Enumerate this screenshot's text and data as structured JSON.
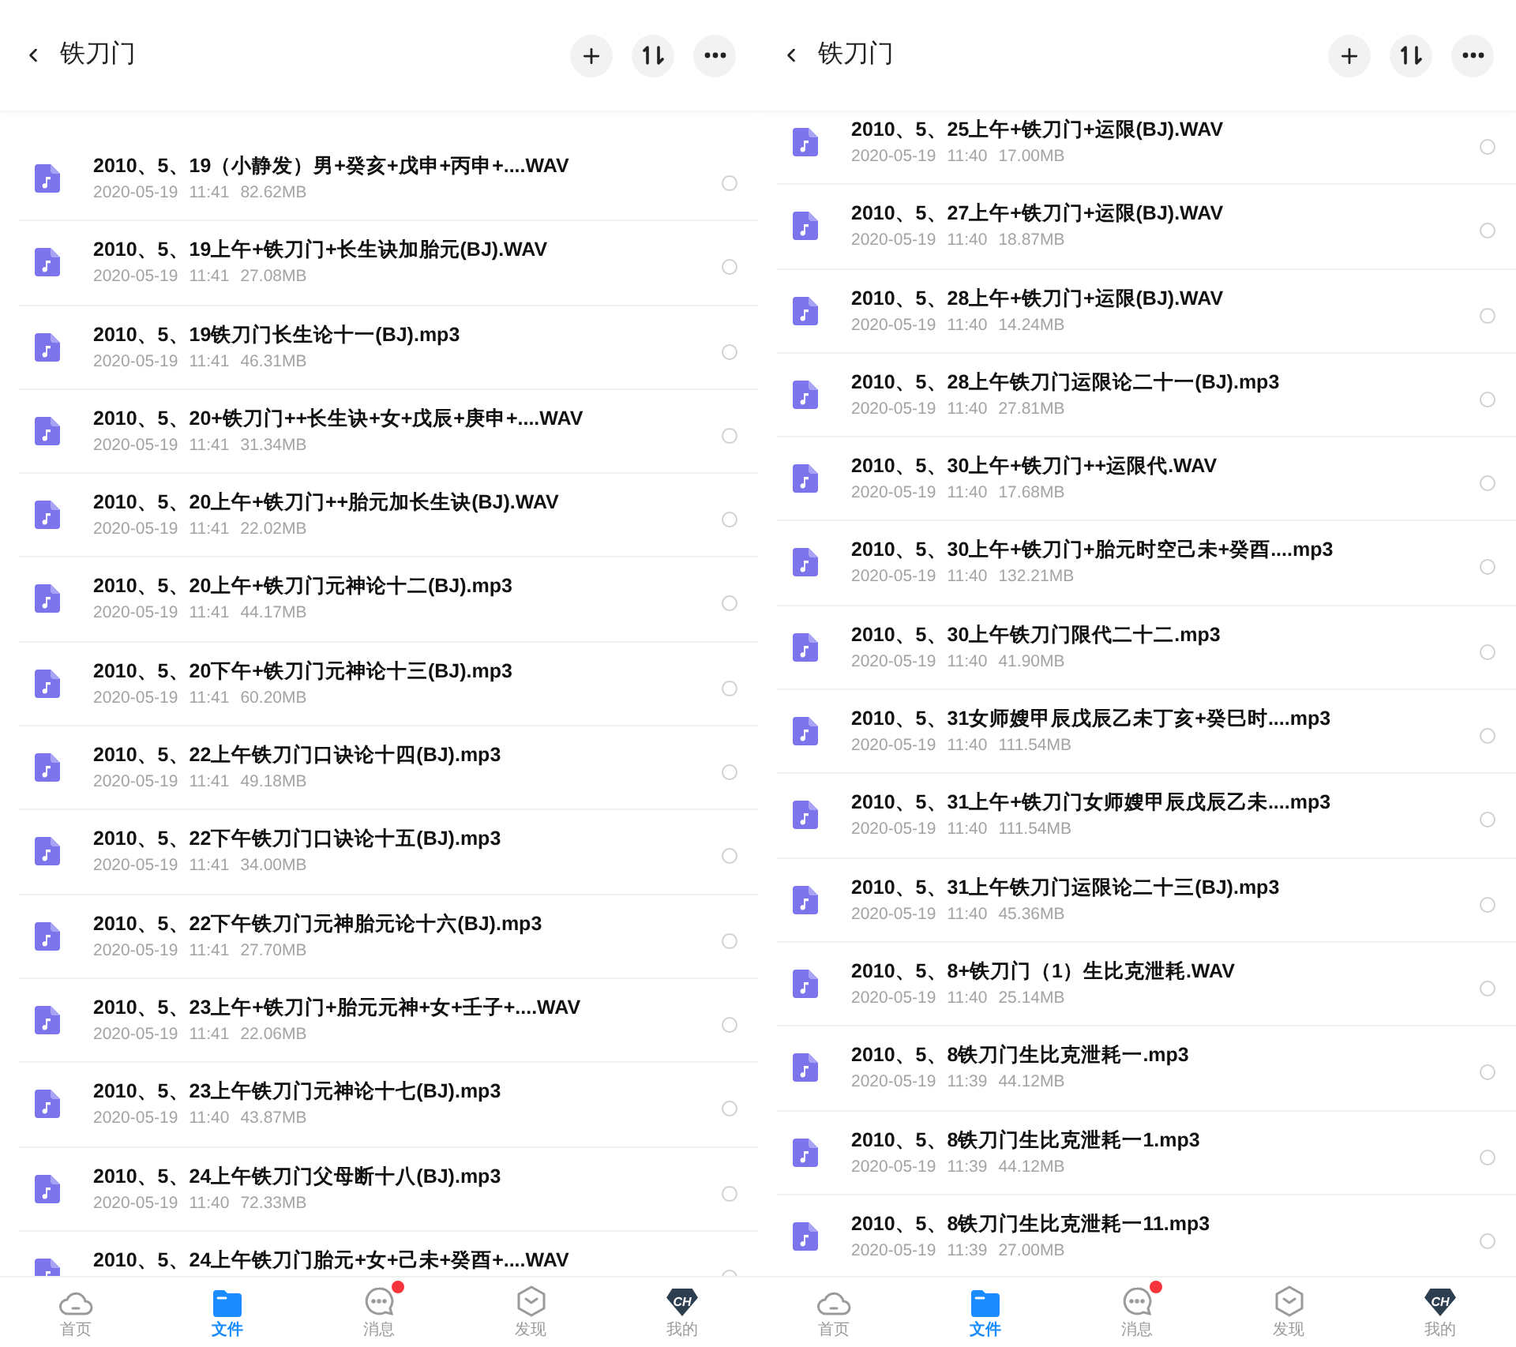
{
  "screens": [
    {
      "header": {
        "title": "铁刀门"
      },
      "files": [
        {
          "name": "2010、5、19（小静发）男+癸亥+戊申+丙申+....WAV",
          "date": "2020-05-19",
          "time": "11:41",
          "size": "82.62MB",
          "selected": false
        },
        {
          "name": "2010、5、19上午+铁刀门+长生诀加胎元(BJ).WAV",
          "date": "2020-05-19",
          "time": "11:41",
          "size": "27.08MB",
          "selected": false
        },
        {
          "name": "2010、5、19铁刀门长生论十一(BJ).mp3",
          "date": "2020-05-19",
          "time": "11:41",
          "size": "46.31MB",
          "selected": false
        },
        {
          "name": "2010、5、20+铁刀门++长生诀+女+戊辰+庚申+....WAV",
          "date": "2020-05-19",
          "time": "11:41",
          "size": "31.34MB",
          "selected": false
        },
        {
          "name": "2010、5、20上午+铁刀门++胎元加长生诀(BJ).WAV",
          "date": "2020-05-19",
          "time": "11:41",
          "size": "22.02MB",
          "selected": false
        },
        {
          "name": "2010、5、20上午+铁刀门元神论十二(BJ).mp3",
          "date": "2020-05-19",
          "time": "11:41",
          "size": "44.17MB",
          "selected": false
        },
        {
          "name": "2010、5、20下午+铁刀门元神论十三(BJ).mp3",
          "date": "2020-05-19",
          "time": "11:41",
          "size": "60.20MB",
          "selected": false
        },
        {
          "name": "2010、5、22上午铁刀门口诀论十四(BJ).mp3",
          "date": "2020-05-19",
          "time": "11:41",
          "size": "49.18MB",
          "selected": false
        },
        {
          "name": "2010、5、22下午铁刀门口诀论十五(BJ).mp3",
          "date": "2020-05-19",
          "time": "11:41",
          "size": "34.00MB",
          "selected": false
        },
        {
          "name": "2010、5、22下午铁刀门元神胎元论十六(BJ).mp3",
          "date": "2020-05-19",
          "time": "11:41",
          "size": "27.70MB",
          "selected": false
        },
        {
          "name": "2010、5、23上午+铁刀门+胎元元神+女+壬子+....WAV",
          "date": "2020-05-19",
          "time": "11:41",
          "size": "22.06MB",
          "selected": false
        },
        {
          "name": "2010、5、23上午铁刀门元神论十七(BJ).mp3",
          "date": "2020-05-19",
          "time": "11:40",
          "size": "43.87MB",
          "selected": false
        },
        {
          "name": "2010、5、24上午铁刀门父母断十八(BJ).mp3",
          "date": "2020-05-19",
          "time": "11:40",
          "size": "72.33MB",
          "selected": false
        },
        {
          "name": "2010、5、24上午铁刀门胎元+女+己未+癸酉+....WAV",
          "selected": false
        }
      ],
      "nav": [
        {
          "kind": "home",
          "label": "首页",
          "selected": false,
          "badge": false
        },
        {
          "kind": "files",
          "label": "文件",
          "selected": true,
          "badge": false
        },
        {
          "kind": "messages",
          "label": "消息",
          "selected": false,
          "badge": true
        },
        {
          "kind": "discover",
          "label": "发现",
          "selected": false,
          "badge": false
        },
        {
          "kind": "profile",
          "label": "我的",
          "selected": false,
          "badge": false,
          "avatar_text": "CH"
        }
      ]
    },
    {
      "header": {
        "title": "铁刀门"
      },
      "files": [
        {
          "name": "2010、5、25上午+铁刀门+运限(BJ).WAV",
          "date": "2020-05-19",
          "time": "11:40",
          "size": "17.00MB",
          "selected": false
        },
        {
          "name": "2010、5、27上午+铁刀门+运限(BJ).WAV",
          "date": "2020-05-19",
          "time": "11:40",
          "size": "18.87MB",
          "selected": false
        },
        {
          "name": "2010、5、28上午+铁刀门+运限(BJ).WAV",
          "date": "2020-05-19",
          "time": "11:40",
          "size": "14.24MB",
          "selected": false
        },
        {
          "name": "2010、5、28上午铁刀门运限论二十一(BJ).mp3",
          "date": "2020-05-19",
          "time": "11:40",
          "size": "27.81MB",
          "selected": false
        },
        {
          "name": "2010、5、30上午+铁刀门++运限代.WAV",
          "date": "2020-05-19",
          "time": "11:40",
          "size": "17.68MB",
          "selected": false
        },
        {
          "name": "2010、5、30上午+铁刀门+胎元时空己未+癸酉....mp3",
          "date": "2020-05-19",
          "time": "11:40",
          "size": "132.21MB",
          "selected": false
        },
        {
          "name": "2010、5、30上午铁刀门限代二十二.mp3",
          "date": "2020-05-19",
          "time": "11:40",
          "size": "41.90MB",
          "selected": false
        },
        {
          "name": "2010、5、31女师嫂甲辰戊辰乙未丁亥+癸巳时....mp3",
          "date": "2020-05-19",
          "time": "11:40",
          "size": "111.54MB",
          "selected": false
        },
        {
          "name": "2010、5、31上午+铁刀门女师嫂甲辰戊辰乙未....mp3",
          "date": "2020-05-19",
          "time": "11:40",
          "size": "111.54MB",
          "selected": false
        },
        {
          "name": "2010、5、31上午铁刀门运限论二十三(BJ).mp3",
          "date": "2020-05-19",
          "time": "11:40",
          "size": "45.36MB",
          "selected": false
        },
        {
          "name": "2010、5、8+铁刀门（1）生比克泄耗.WAV",
          "date": "2020-05-19",
          "time": "11:40",
          "size": "25.14MB",
          "selected": false
        },
        {
          "name": "2010、5、8铁刀门生比克泄耗一.mp3",
          "date": "2020-05-19",
          "time": "11:39",
          "size": "44.12MB",
          "selected": false
        },
        {
          "name": "2010、5、8铁刀门生比克泄耗一1.mp3",
          "date": "2020-05-19",
          "time": "11:39",
          "size": "44.12MB",
          "selected": false
        },
        {
          "name": "2010、5、8铁刀门生比克泄耗一11.mp3",
          "date": "2020-05-19",
          "time": "11:39",
          "size": "27.00MB",
          "selected": false
        }
      ],
      "nav": [
        {
          "kind": "home",
          "label": "首页",
          "selected": false,
          "badge": false
        },
        {
          "kind": "files",
          "label": "文件",
          "selected": true,
          "badge": false
        },
        {
          "kind": "messages",
          "label": "消息",
          "selected": false,
          "badge": true
        },
        {
          "kind": "discover",
          "label": "发现",
          "selected": false,
          "badge": false
        },
        {
          "kind": "profile",
          "label": "我的",
          "selected": false,
          "badge": false,
          "avatar_text": "CH"
        }
      ]
    }
  ]
}
